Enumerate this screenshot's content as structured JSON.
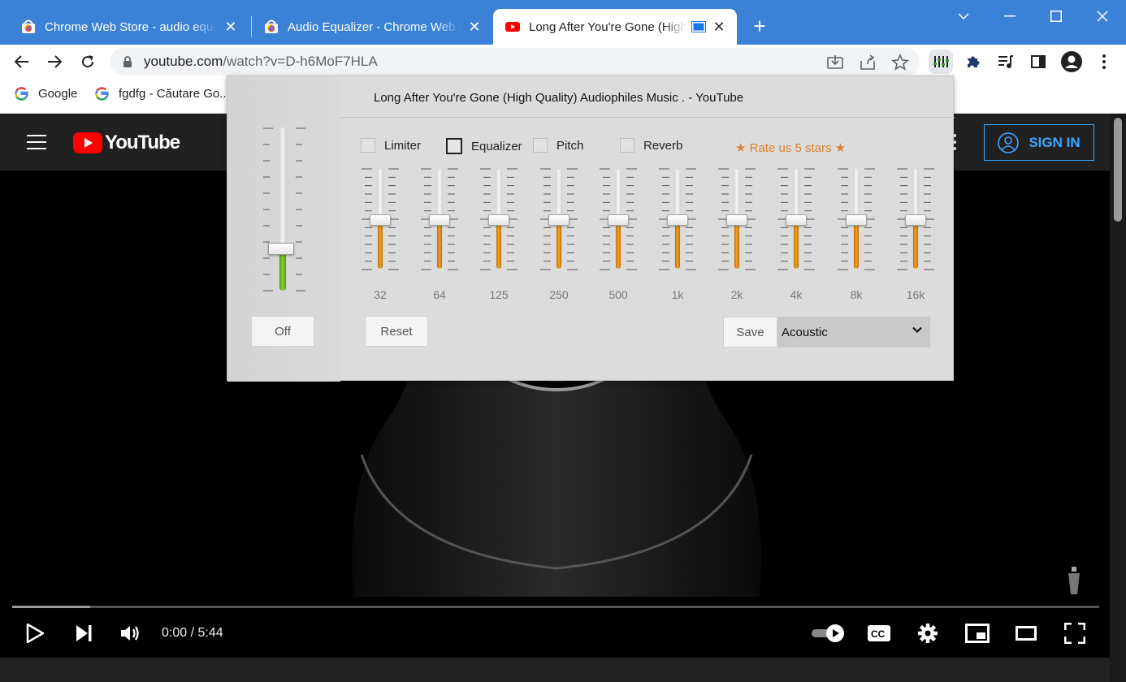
{
  "tabs": [
    {
      "title": "Chrome Web Store - audio equal",
      "icon": "chrome-web-store-icon"
    },
    {
      "title": "Audio Equalizer - Chrome Web St",
      "icon": "chrome-web-store-icon"
    },
    {
      "title": "Long After You're Gone (High Q",
      "icon": "youtube-icon",
      "active": true
    }
  ],
  "address_bar": {
    "host": "youtube.com",
    "path": "/watch?v=D-h6MoF7HLA"
  },
  "bookmarks": [
    {
      "label": "Google",
      "icon": "google-icon"
    },
    {
      "label": "fgdfg - Căutare Go...",
      "icon": "google-icon"
    }
  ],
  "youtube": {
    "logo": "YouTube",
    "sign_in": "SIGN IN",
    "player": {
      "time": "0:00 / 5:44",
      "progress_loaded": 0.072
    }
  },
  "equalizer": {
    "title": "Long After You're Gone (High Quality) Audiophiles Music . - YouTube",
    "checkboxes": [
      {
        "label": "Limiter",
        "checked": false
      },
      {
        "label": "Equalizer",
        "checked": true
      },
      {
        "label": "Pitch",
        "checked": false
      },
      {
        "label": "Reverb",
        "checked": false
      }
    ],
    "rate": "★ Rate us 5 stars ★",
    "bands": [
      {
        "freq": "32",
        "level": 0.5
      },
      {
        "freq": "64",
        "level": 0.5
      },
      {
        "freq": "125",
        "level": 0.5
      },
      {
        "freq": "250",
        "level": 0.5
      },
      {
        "freq": "500",
        "level": 0.5
      },
      {
        "freq": "1k",
        "level": 0.5
      },
      {
        "freq": "2k",
        "level": 0.5
      },
      {
        "freq": "4k",
        "level": 0.5
      },
      {
        "freq": "8k",
        "level": 0.5
      },
      {
        "freq": "16k",
        "level": 0.5
      }
    ],
    "volume_level": 0.26,
    "off_label": "Off",
    "reset_label": "Reset",
    "save_label": "Save",
    "preset": "Acoustic",
    "accent_color": "#f2a227",
    "volume_color": "#7cc42c"
  }
}
